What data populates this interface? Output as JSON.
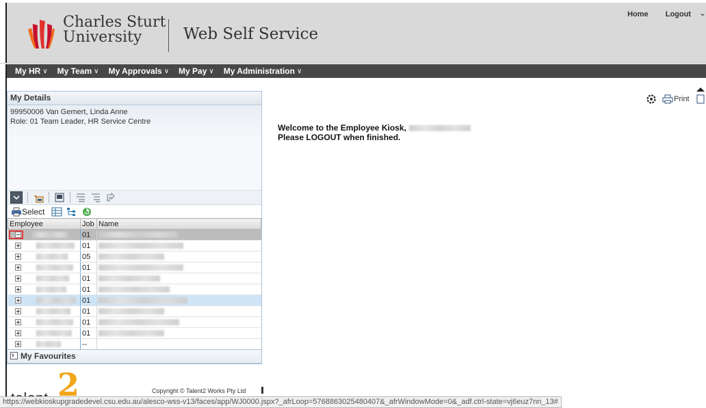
{
  "header": {
    "logo_line1": "Charles Sturt",
    "logo_line2": "University",
    "app_title": "Web Self Service",
    "links": {
      "home": "Home",
      "logout": "Logout"
    }
  },
  "menu": [
    {
      "label": "My HR"
    },
    {
      "label": "My Team"
    },
    {
      "label": "My Approvals"
    },
    {
      "label": "My Pay"
    },
    {
      "label": "My Administration"
    }
  ],
  "panel": {
    "title": "My Details",
    "detail_line1": "99950006 Van Gemert, Linda Anne",
    "detail_line2": "Role: 01 Team Leader, HR Service Centre",
    "select_label": "Select",
    "grid": {
      "headers": {
        "employee": "Employee",
        "job": "Job",
        "name": "Name"
      },
      "rows": [
        {
          "job": "01"
        },
        {
          "job": "01"
        },
        {
          "job": "05"
        },
        {
          "job": "01"
        },
        {
          "job": "01"
        },
        {
          "job": "01"
        },
        {
          "job": "01"
        },
        {
          "job": "01"
        },
        {
          "job": "01"
        },
        {
          "job": "01"
        },
        {
          "job": "--"
        },
        {
          "job": "--"
        }
      ]
    },
    "favourites": "My Favourites"
  },
  "main": {
    "welcome_line1": "Welcome to the Employee Kiosk,",
    "welcome_line2": "Please LOGOUT when finished.",
    "print_label": "Print"
  },
  "footer": {
    "brand_partial": "talent",
    "brand_number": "2",
    "copyright": "Copyright © Talent2 Works Pty Ltd",
    "status_url": "https://webkioskupgradedevel.csu.edu.au/alesco-wss-v13/faces/app/WJ0000.jspx?_afrLoop=5768863025480407&_afrWindowMode=0&_adf.ctrl-state=vj6euz7nn_13#"
  },
  "colors": {
    "menu_bg": "#474747",
    "header_bg": "#d9d9d9",
    "brand_red": "#c8102e",
    "brand_orange": "#f0a51a",
    "selected_row": "#cfe4f6"
  }
}
